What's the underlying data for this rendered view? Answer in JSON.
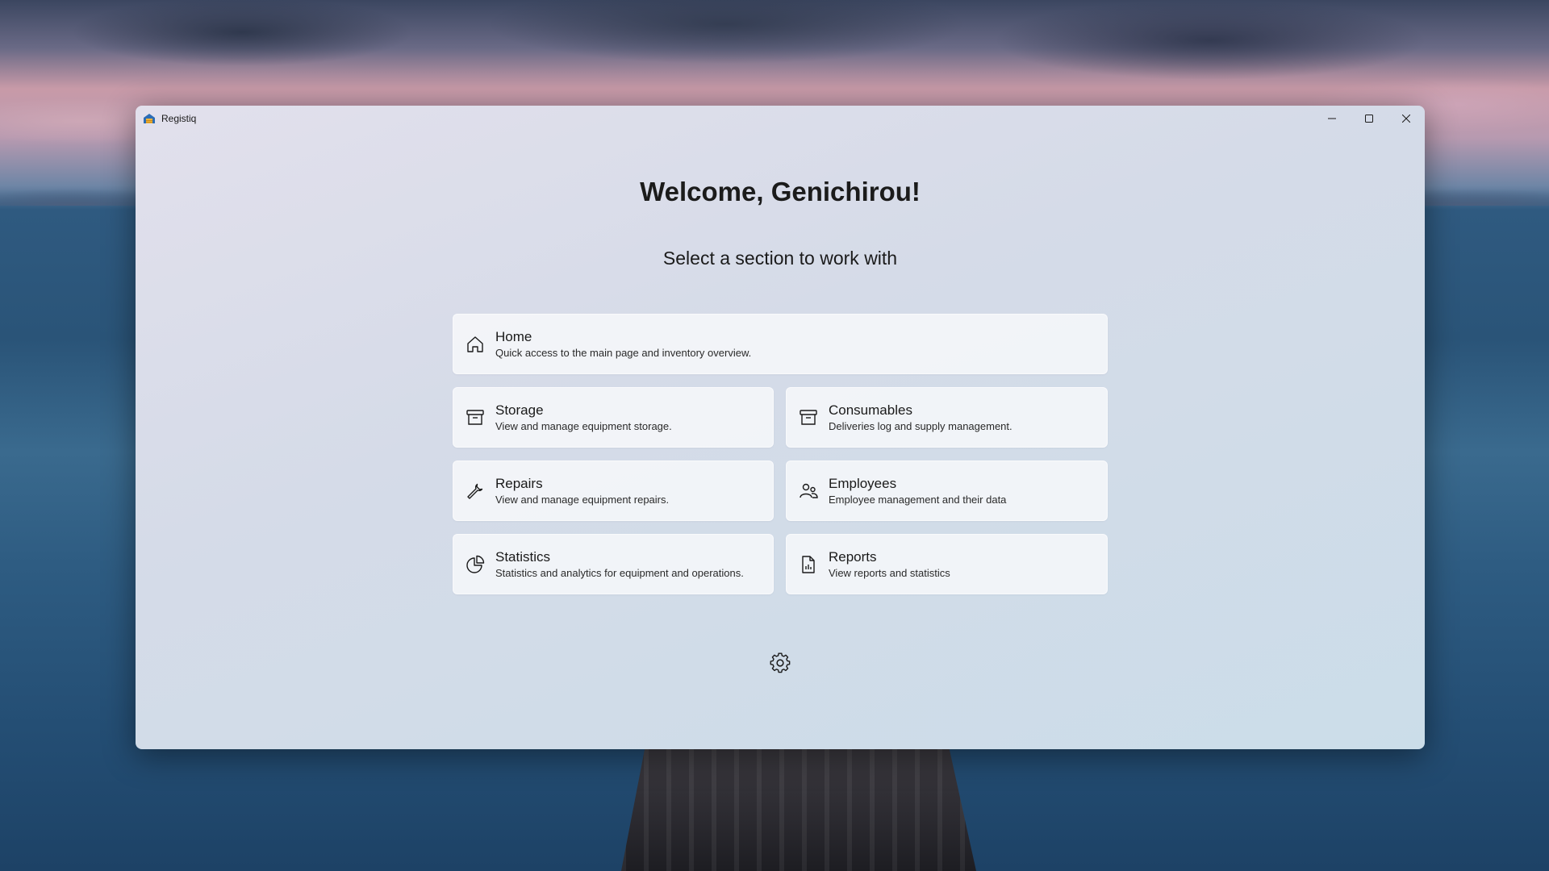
{
  "window": {
    "title": "Registiq"
  },
  "main": {
    "welcome": "Welcome, Genichirou!",
    "subtitle": "Select a section to work with"
  },
  "sections": {
    "home": {
      "title": "Home",
      "description": "Quick access to the main page and inventory overview.",
      "icon": "home-icon"
    },
    "storage": {
      "title": "Storage",
      "description": "View and manage equipment storage.",
      "icon": "archive-box-icon"
    },
    "consumables": {
      "title": "Consumables",
      "description": "Deliveries log and supply management.",
      "icon": "archive-box-icon"
    },
    "repairs": {
      "title": "Repairs",
      "description": "View and manage equipment repairs.",
      "icon": "wrench-icon"
    },
    "employees": {
      "title": "Employees",
      "description": "Employee management and their data",
      "icon": "people-icon"
    },
    "statistics": {
      "title": "Statistics",
      "description": "Statistics and analytics for equipment and operations.",
      "icon": "pie-chart-icon"
    },
    "reports": {
      "title": "Reports",
      "description": "View reports and statistics",
      "icon": "report-document-icon"
    }
  },
  "colors": {
    "card_background": "#f8f9fb",
    "window_background": "#d5dbe8",
    "text": "#1a1a1a"
  }
}
